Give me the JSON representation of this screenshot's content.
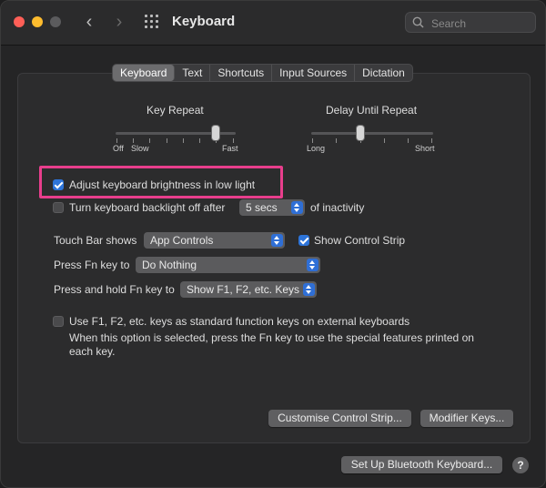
{
  "window": {
    "title": "Keyboard"
  },
  "search": {
    "placeholder": "Search"
  },
  "tabs": [
    {
      "label": "Keyboard",
      "active": true
    },
    {
      "label": "Text",
      "active": false
    },
    {
      "label": "Shortcuts",
      "active": false
    },
    {
      "label": "Input Sources",
      "active": false
    },
    {
      "label": "Dictation",
      "active": false
    }
  ],
  "key_repeat": {
    "label": "Key Repeat",
    "left_label_1": "Off",
    "left_label_2": "Slow",
    "right_label": "Fast"
  },
  "delay_until_repeat": {
    "label": "Delay Until Repeat",
    "left_label": "Long",
    "right_label": "Short"
  },
  "options": {
    "adjust_brightness": {
      "label": "Adjust keyboard brightness in low light",
      "checked": true
    },
    "backlight_off": {
      "label": "Turn keyboard backlight off after",
      "checked": false,
      "value": "5 secs",
      "suffix": "of inactivity"
    },
    "touch_bar_shows": {
      "label": "Touch Bar shows",
      "value": "App Controls"
    },
    "show_control_strip": {
      "label": "Show Control Strip",
      "checked": true
    },
    "press_fn": {
      "label": "Press Fn key to",
      "value": "Do Nothing"
    },
    "press_hold_fn": {
      "label": "Press and hold Fn key to",
      "value": "Show F1, F2, etc. Keys"
    },
    "use_f_keys": {
      "label": "Use F1, F2, etc. keys as standard function keys on external keyboards",
      "checked": false,
      "description_line1": "When this option is selected, press the Fn key to use the special features printed on",
      "description_line2": "each key."
    }
  },
  "buttons": {
    "customise_control_strip": "Customise Control Strip...",
    "modifier_keys": "Modifier Keys...",
    "setup_bluetooth": "Set Up Bluetooth Keyboard...",
    "help": "?"
  },
  "colors": {
    "accent": "#2d74d9",
    "highlight": "#e83e8c"
  }
}
